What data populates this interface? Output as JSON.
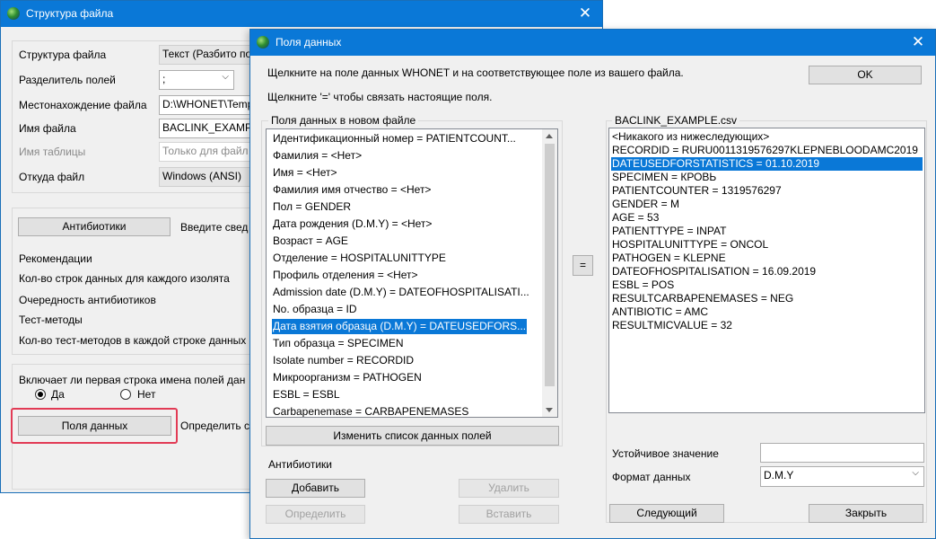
{
  "back_window": {
    "title": "Структура файла",
    "rows": [
      {
        "label": "Структура файла",
        "value": "Текст (Разбито по"
      },
      {
        "label": "Разделитель полей",
        "value": ";"
      },
      {
        "label": "Местонахождение файла",
        "value": "D:\\WHONET\\Temp"
      },
      {
        "label": "Имя файла",
        "value": "BACLINK_EXAMP"
      },
      {
        "label": "Имя таблицы",
        "value": "Только для файл"
      },
      {
        "label": "Откуда файл",
        "value": "Windows (ANSI)"
      }
    ],
    "antibiotics_button": "Антибиотики",
    "antibiotics_hint": "Введите свед",
    "settings_items": [
      "Рекомендации",
      "Кол-во строк данных для каждого изолята",
      "Очередность антибиотиков",
      "Тест-методы",
      "Кол-во тест-методов в каждой строке данных"
    ],
    "first_row_question": "Включает ли первая строка имена полей дан",
    "radio_yes": "Да",
    "radio_no": "Нет",
    "data_fields_button": "Поля данных",
    "data_fields_hint": "Определить с"
  },
  "front_window": {
    "title": "Поля данных",
    "instruction_1": "Щелкните на поле данных WHONET и на соответствующее поле из вашего файла.",
    "instruction_2": "Щелкните '=' чтобы связать настоящие поля.",
    "ok_button": "OK",
    "left_group_title": "Поля данных в новом файле",
    "left_list": [
      "Идентификационный номер = PATIENTCOUNT...",
      "Фамилия = <Нет>",
      "Имя = <Нет>",
      "Фамилия имя отчество = <Нет>",
      "Пол = GENDER",
      "Дата рождения (D.M.Y) = <Нет>",
      "Возраст = AGE",
      "Отделение = HOSPITALUNITTYPE",
      "Профиль отделения = <Нет>",
      "Admission date (D.M.Y) = DATEOFHOSPITALISATI...",
      "No. образца = ID",
      "Дата взятия образца (D.M.Y) = DATEUSEDFORS...",
      "Тип образца = SPECIMEN",
      "Isolate number = RECORDID",
      "Микроорганизм = PATHOGEN",
      "ESBL = ESBL",
      "Carbapenemase = CARBAPENEMASES"
    ],
    "left_selected_index": 11,
    "change_list_button": "Изменить список данных полей",
    "antibiotics_label": "Антибиотики",
    "add_button": "Добавить",
    "delete_button": "Удалить",
    "define_button": "Определить",
    "insert_button": "Вставить",
    "equals_button": "=",
    "right_group_title": "BACLINK_EXAMPLE.csv",
    "right_list": [
      "<Никакого из нижеследующих>",
      "RECORDID = RURU0011319576297KLEPNEBLOODAMC2019",
      "DATEUSEDFORSTATISTICS = 01.10.2019",
      "SPECIMEN = КРОВЬ",
      "PATIENTCOUNTER = 1319576297",
      "GENDER = M",
      "AGE = 53",
      "PATIENTTYPE = INPAT",
      "HOSPITALUNITTYPE = ONCOL",
      "PATHOGEN = KLEPNE",
      "DATEOFHOSPITALISATION = 16.09.2019",
      "ESBL = POS",
      "RESULTCARBAPENEMASES = NEG",
      "ANTIBIOTIC = AMC",
      "RESULTMICVALUE = 32"
    ],
    "right_selected_index": 2,
    "constant_value_label": "Устойчивое значение",
    "constant_value": "",
    "date_format_label": "Формат данных",
    "date_format_value": "D.M.Y",
    "next_button": "Следующий",
    "close_button": "Закрыть"
  },
  "colors": {
    "titlebar": "#0a78d7",
    "selection": "#0a78d7",
    "highlight_frame": "#e23b55"
  }
}
